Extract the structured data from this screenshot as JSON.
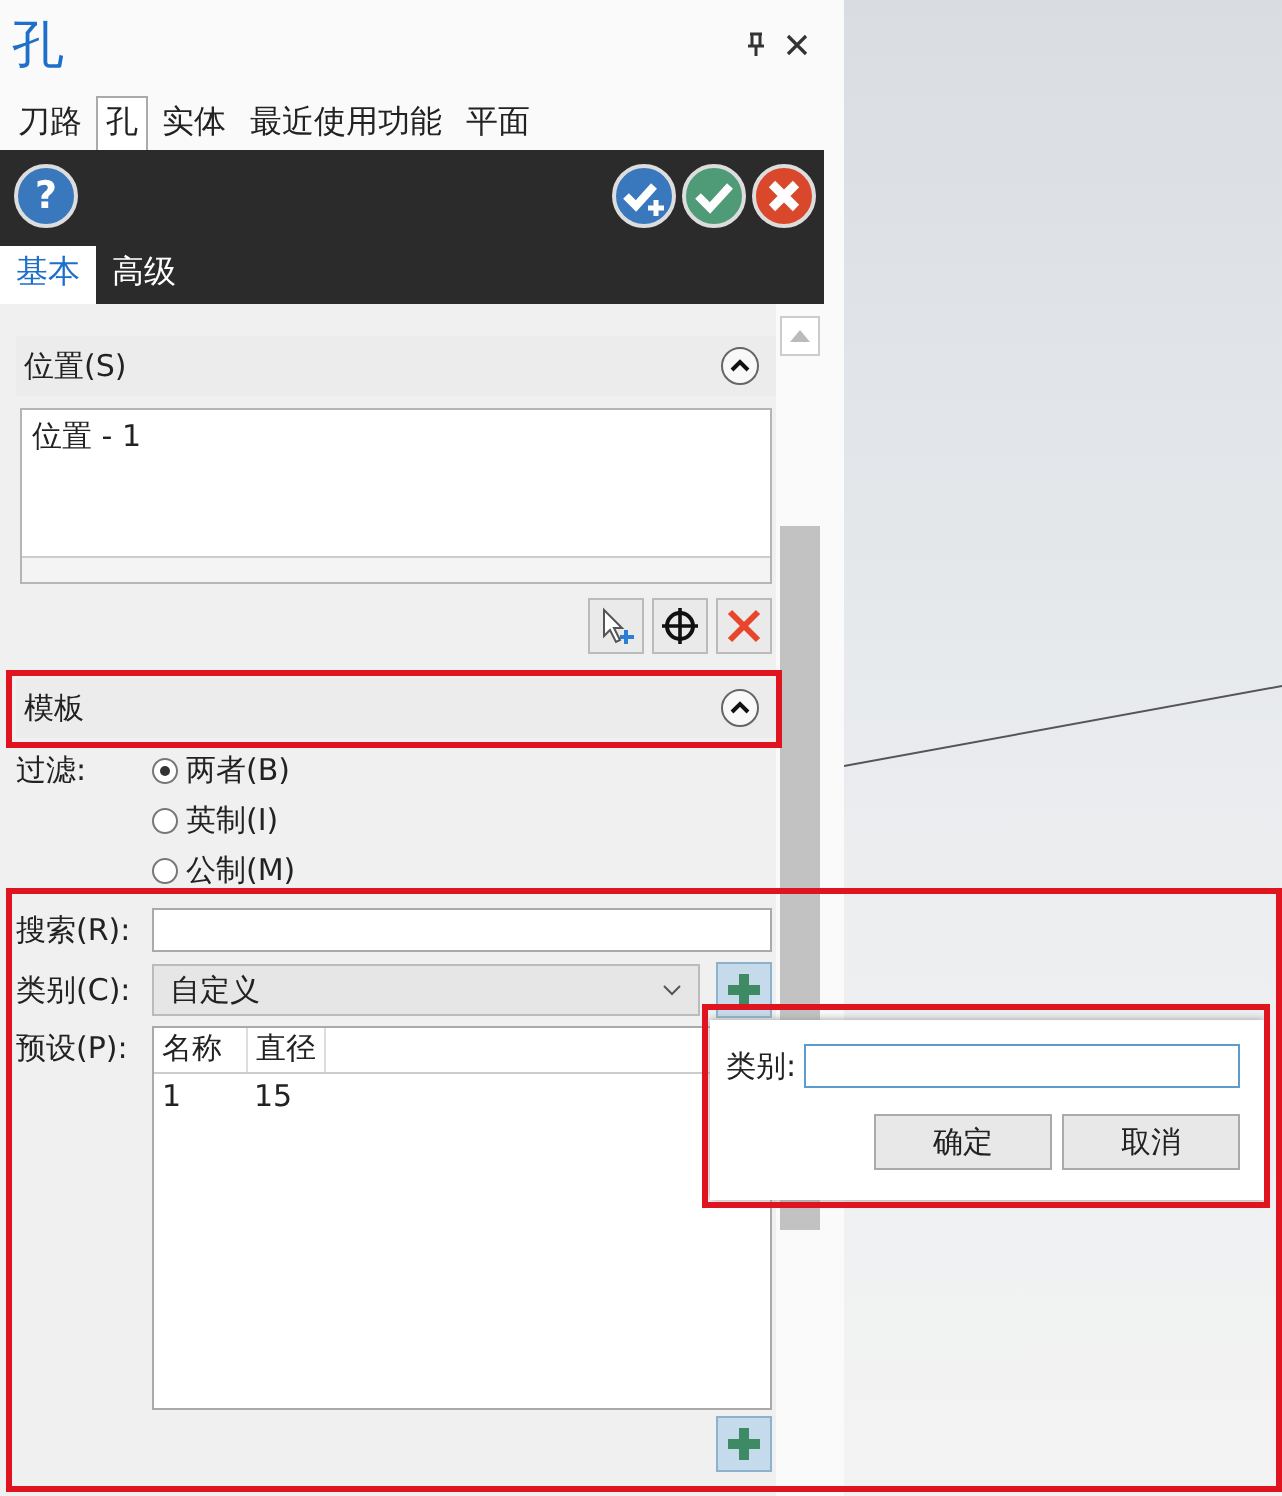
{
  "panel": {
    "title": "孔",
    "ribbon_tabs": [
      {
        "label": "刀路",
        "selected": false
      },
      {
        "label": "孔",
        "selected": true
      },
      {
        "label": "实体",
        "selected": false
      },
      {
        "label": "最近使用功能",
        "selected": false
      },
      {
        "label": "平面",
        "selected": false
      }
    ],
    "help_button": "?",
    "subtabs": [
      {
        "label": "基本",
        "selected": true
      },
      {
        "label": "高级",
        "selected": false
      }
    ],
    "position_section": {
      "title": "位置(S)",
      "expanded": true,
      "items": [
        "位置 - 1"
      ]
    },
    "template_section": {
      "title": "模板",
      "expanded": true,
      "filter_label": "过滤:",
      "filter_options": [
        {
          "label": "两者(B)",
          "selected": true
        },
        {
          "label": "英制(I)",
          "selected": false
        },
        {
          "label": "公制(M)",
          "selected": false
        }
      ],
      "search_label": "搜索(R):",
      "category_label": "类别(C):",
      "category_value": "自定义",
      "preset_label": "预设(P):",
      "preset_columns": [
        "名称",
        "直径"
      ],
      "preset_rows": [
        [
          "1",
          "15"
        ]
      ]
    }
  },
  "popup": {
    "label": "类别:",
    "buttons": [
      "确定",
      "取消"
    ]
  }
}
